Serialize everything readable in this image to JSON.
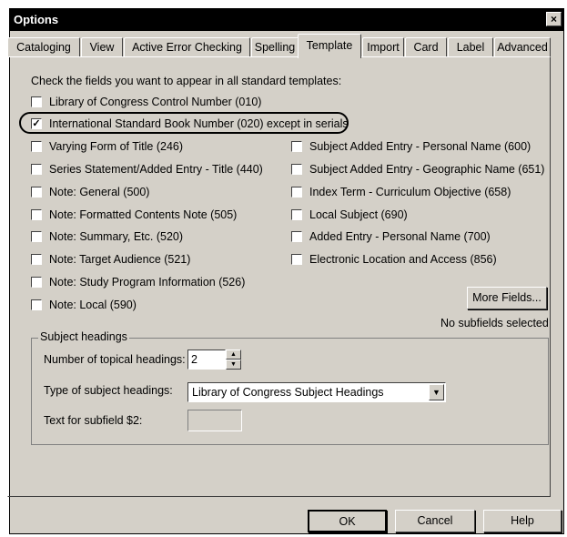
{
  "window": {
    "title": "Options",
    "close_glyph": "×"
  },
  "tabs": [
    "Cataloging",
    "View",
    "Active Error Checking",
    "Spelling",
    "Template",
    "Import",
    "Card",
    "Label",
    "Advanced"
  ],
  "active_tab": "Template",
  "instructions": "Check the fields you want to appear in all standard templates:",
  "fields_col1": [
    {
      "label": "Library of Congress Control Number (010)",
      "checked": false
    },
    {
      "label": "International Standard Book Number (020) except in serials",
      "checked": true
    },
    {
      "label": "Varying Form of Title (246)",
      "checked": false
    },
    {
      "label": "Series Statement/Added Entry - Title (440)",
      "checked": false
    },
    {
      "label": "Note: General (500)",
      "checked": false
    },
    {
      "label": "Note: Formatted Contents Note (505)",
      "checked": false
    },
    {
      "label": "Note: Summary, Etc. (520)",
      "checked": false
    },
    {
      "label": "Note: Target Audience (521)",
      "checked": false
    },
    {
      "label": "Note: Study Program Information (526)",
      "checked": false
    },
    {
      "label": "Note: Local (590)",
      "checked": false
    }
  ],
  "fields_col2": [
    {
      "label": "Subject Added Entry - Personal Name (600)",
      "checked": false
    },
    {
      "label": "Subject Added Entry - Geographic Name (651)",
      "checked": false
    },
    {
      "label": "Index Term - Curriculum Objective (658)",
      "checked": false
    },
    {
      "label": "Local Subject (690)",
      "checked": false
    },
    {
      "label": "Added Entry - Personal Name (700)",
      "checked": false
    },
    {
      "label": "Electronic Location and Access (856)",
      "checked": false
    }
  ],
  "more_fields_label": "More Fields...",
  "subfields_status": "No subfields selected",
  "subject_headings": {
    "legend": "Subject headings",
    "topical_label": "Number of topical headings:",
    "topical_value": "2",
    "type_label": "Type of subject headings:",
    "type_value": "Library of Congress Subject Headings",
    "subfield_label": "Text for subfield $2:",
    "subfield_value": ""
  },
  "buttons": {
    "ok": "OK",
    "cancel": "Cancel",
    "help": "Help"
  }
}
